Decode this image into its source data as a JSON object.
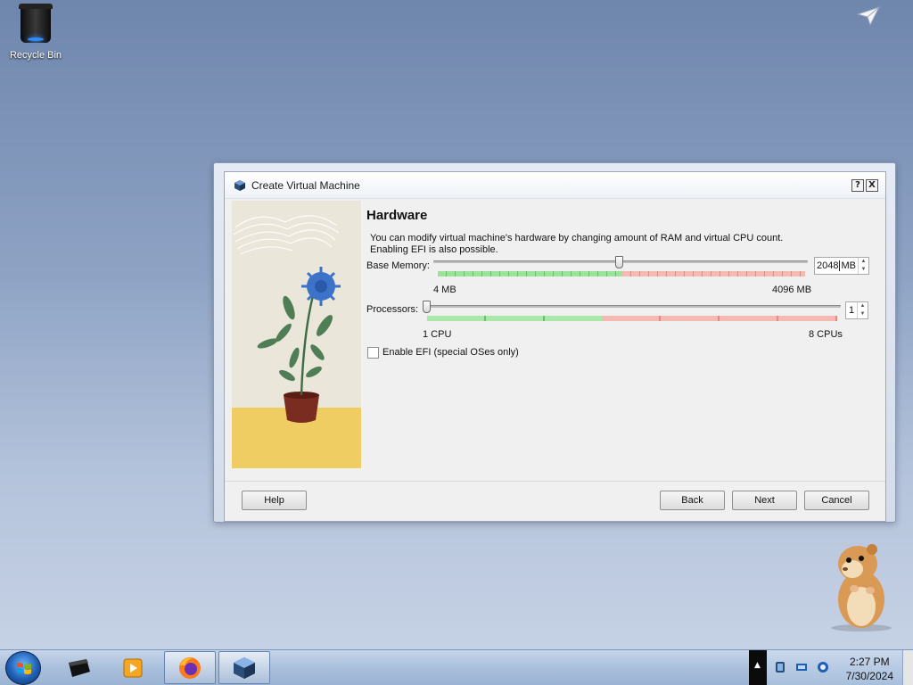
{
  "desktop": {
    "recycle_bin_label": "Recycle Bin"
  },
  "window": {
    "title": "Create Virtual Machine",
    "help_glyph": "?",
    "close_glyph": "X"
  },
  "page": {
    "title": "Hardware",
    "description_line1": "You can modify virtual machine's hardware by changing amount of RAM and virtual CPU count.",
    "description_line2": "Enabling EFI is also possible."
  },
  "memory": {
    "label": "Base Memory:",
    "value": "2048",
    "unit": "MB",
    "min_label": "4 MB",
    "max_label": "4096 MB",
    "level_fraction": 0.5
  },
  "processors": {
    "label": "Processors:",
    "value": "1",
    "min_label": "1 CPU",
    "max_label": "8 CPUs",
    "level_fraction": 0.0
  },
  "efi": {
    "label": "Enable EFI (special OSes only)",
    "checked": false
  },
  "buttons": {
    "help": "Help",
    "back": "Back",
    "next": "Next",
    "cancel": "Cancel"
  },
  "taskbar": {
    "apps": [
      "terminal-icon",
      "media-player-icon",
      "firefox-icon",
      "virtualbox-icon"
    ],
    "tray_arrow": "▲",
    "time": "2:27 PM",
    "date": "7/30/2024"
  },
  "colors": {
    "scale_green": "#9be29b",
    "scale_red": "#f4a3a3",
    "accent": "#1f5fb3"
  }
}
